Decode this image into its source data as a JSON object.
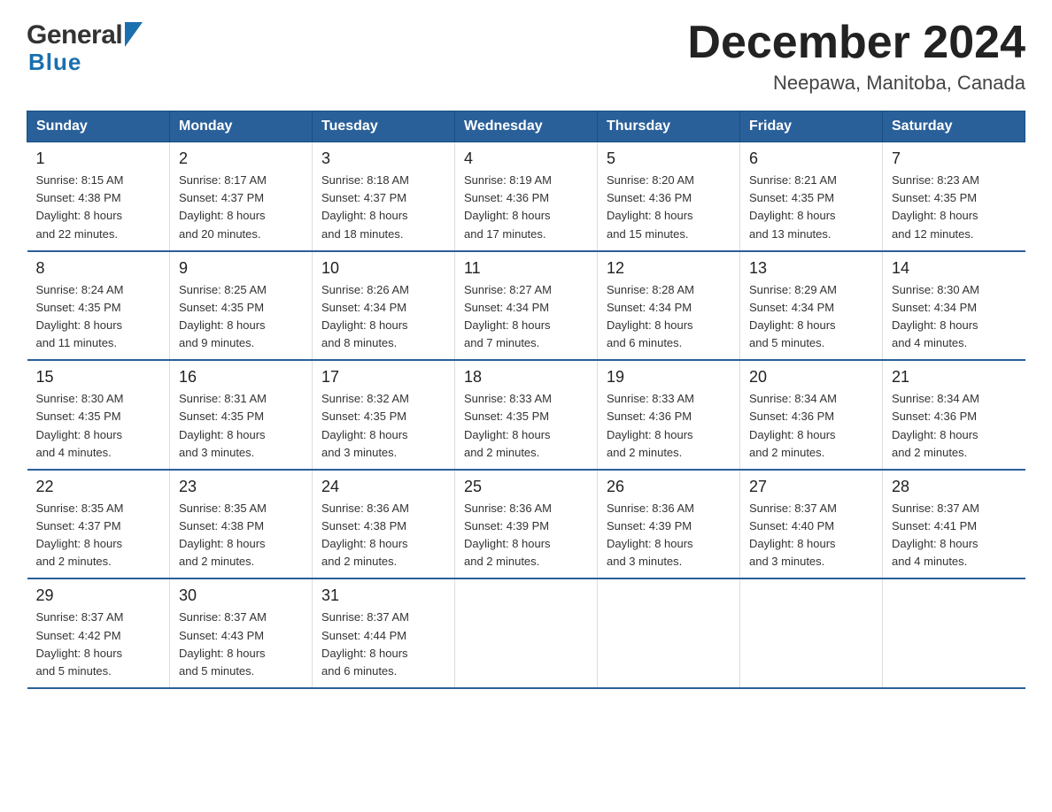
{
  "header": {
    "title": "December 2024",
    "subtitle": "Neepawa, Manitoba, Canada",
    "logo_general": "General",
    "logo_blue": "Blue"
  },
  "days_of_week": [
    "Sunday",
    "Monday",
    "Tuesday",
    "Wednesday",
    "Thursday",
    "Friday",
    "Saturday"
  ],
  "weeks": [
    [
      {
        "day": "1",
        "sunrise": "8:15 AM",
        "sunset": "4:38 PM",
        "daylight": "8 hours and 22 minutes."
      },
      {
        "day": "2",
        "sunrise": "8:17 AM",
        "sunset": "4:37 PM",
        "daylight": "8 hours and 20 minutes."
      },
      {
        "day": "3",
        "sunrise": "8:18 AM",
        "sunset": "4:37 PM",
        "daylight": "8 hours and 18 minutes."
      },
      {
        "day": "4",
        "sunrise": "8:19 AM",
        "sunset": "4:36 PM",
        "daylight": "8 hours and 17 minutes."
      },
      {
        "day": "5",
        "sunrise": "8:20 AM",
        "sunset": "4:36 PM",
        "daylight": "8 hours and 15 minutes."
      },
      {
        "day": "6",
        "sunrise": "8:21 AM",
        "sunset": "4:35 PM",
        "daylight": "8 hours and 13 minutes."
      },
      {
        "day": "7",
        "sunrise": "8:23 AM",
        "sunset": "4:35 PM",
        "daylight": "8 hours and 12 minutes."
      }
    ],
    [
      {
        "day": "8",
        "sunrise": "8:24 AM",
        "sunset": "4:35 PM",
        "daylight": "8 hours and 11 minutes."
      },
      {
        "day": "9",
        "sunrise": "8:25 AM",
        "sunset": "4:35 PM",
        "daylight": "8 hours and 9 minutes."
      },
      {
        "day": "10",
        "sunrise": "8:26 AM",
        "sunset": "4:34 PM",
        "daylight": "8 hours and 8 minutes."
      },
      {
        "day": "11",
        "sunrise": "8:27 AM",
        "sunset": "4:34 PM",
        "daylight": "8 hours and 7 minutes."
      },
      {
        "day": "12",
        "sunrise": "8:28 AM",
        "sunset": "4:34 PM",
        "daylight": "8 hours and 6 minutes."
      },
      {
        "day": "13",
        "sunrise": "8:29 AM",
        "sunset": "4:34 PM",
        "daylight": "8 hours and 5 minutes."
      },
      {
        "day": "14",
        "sunrise": "8:30 AM",
        "sunset": "4:34 PM",
        "daylight": "8 hours and 4 minutes."
      }
    ],
    [
      {
        "day": "15",
        "sunrise": "8:30 AM",
        "sunset": "4:35 PM",
        "daylight": "8 hours and 4 minutes."
      },
      {
        "day": "16",
        "sunrise": "8:31 AM",
        "sunset": "4:35 PM",
        "daylight": "8 hours and 3 minutes."
      },
      {
        "day": "17",
        "sunrise": "8:32 AM",
        "sunset": "4:35 PM",
        "daylight": "8 hours and 3 minutes."
      },
      {
        "day": "18",
        "sunrise": "8:33 AM",
        "sunset": "4:35 PM",
        "daylight": "8 hours and 2 minutes."
      },
      {
        "day": "19",
        "sunrise": "8:33 AM",
        "sunset": "4:36 PM",
        "daylight": "8 hours and 2 minutes."
      },
      {
        "day": "20",
        "sunrise": "8:34 AM",
        "sunset": "4:36 PM",
        "daylight": "8 hours and 2 minutes."
      },
      {
        "day": "21",
        "sunrise": "8:34 AM",
        "sunset": "4:36 PM",
        "daylight": "8 hours and 2 minutes."
      }
    ],
    [
      {
        "day": "22",
        "sunrise": "8:35 AM",
        "sunset": "4:37 PM",
        "daylight": "8 hours and 2 minutes."
      },
      {
        "day": "23",
        "sunrise": "8:35 AM",
        "sunset": "4:38 PM",
        "daylight": "8 hours and 2 minutes."
      },
      {
        "day": "24",
        "sunrise": "8:36 AM",
        "sunset": "4:38 PM",
        "daylight": "8 hours and 2 minutes."
      },
      {
        "day": "25",
        "sunrise": "8:36 AM",
        "sunset": "4:39 PM",
        "daylight": "8 hours and 2 minutes."
      },
      {
        "day": "26",
        "sunrise": "8:36 AM",
        "sunset": "4:39 PM",
        "daylight": "8 hours and 3 minutes."
      },
      {
        "day": "27",
        "sunrise": "8:37 AM",
        "sunset": "4:40 PM",
        "daylight": "8 hours and 3 minutes."
      },
      {
        "day": "28",
        "sunrise": "8:37 AM",
        "sunset": "4:41 PM",
        "daylight": "8 hours and 4 minutes."
      }
    ],
    [
      {
        "day": "29",
        "sunrise": "8:37 AM",
        "sunset": "4:42 PM",
        "daylight": "8 hours and 5 minutes."
      },
      {
        "day": "30",
        "sunrise": "8:37 AM",
        "sunset": "4:43 PM",
        "daylight": "8 hours and 5 minutes."
      },
      {
        "day": "31",
        "sunrise": "8:37 AM",
        "sunset": "4:44 PM",
        "daylight": "8 hours and 6 minutes."
      },
      null,
      null,
      null,
      null
    ]
  ],
  "labels": {
    "sunrise": "Sunrise:",
    "sunset": "Sunset:",
    "daylight": "Daylight:"
  }
}
